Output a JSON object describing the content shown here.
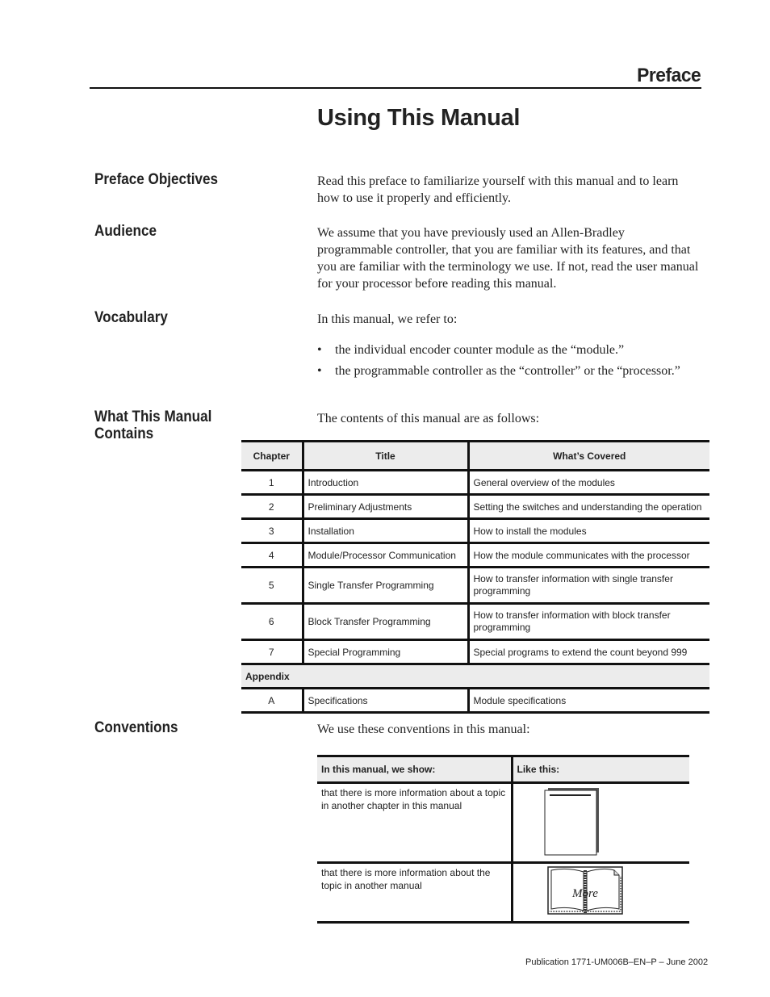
{
  "header": {
    "section_label": "Preface",
    "page_title": "Using This Manual"
  },
  "sections": {
    "objectives": {
      "heading": "Preface Objectives",
      "text": "Read this preface to familiarize yourself with this manual and to learn how to use it properly and efficiently."
    },
    "audience": {
      "heading": "Audience",
      "text": "We assume that you have previously used an Allen-Bradley programmable controller, that you are familiar with its features, and that you are familiar with the terminology we use.  If not, read the user manual for your processor before reading this manual."
    },
    "vocabulary": {
      "heading": "Vocabulary",
      "intro": "In this manual, we refer to:",
      "bullets": [
        "the individual encoder counter module as the “module.”",
        "the programmable controller as the “controller” or the “processor.”"
      ]
    },
    "contents": {
      "heading_line1": "What This Manual",
      "heading_line2": "Contains",
      "intro": "The contents of this manual are as follows:",
      "columns": [
        "Chapter",
        "Title",
        "What’s Covered"
      ],
      "rows": [
        {
          "chapter": "1",
          "title": "Introduction",
          "covered": "General overview of the modules"
        },
        {
          "chapter": "2",
          "title": "Preliminary Adjustments",
          "covered": "Setting the switches and understanding the operation"
        },
        {
          "chapter": "3",
          "title": "Installation",
          "covered": "How to install the modules"
        },
        {
          "chapter": "4",
          "title": "Module/Processor Communication",
          "covered": "How the module communicates with the processor"
        },
        {
          "chapter": "5",
          "title": "Single Transfer Programming",
          "covered": "How to transfer information with single transfer programming"
        },
        {
          "chapter": "6",
          "title": "Block Transfer Programming",
          "covered": "How to transfer information with block transfer programming"
        },
        {
          "chapter": "7",
          "title": "Special Programming",
          "covered": "Special programs to extend the count beyond 999"
        }
      ],
      "appendix_label": "Appendix",
      "appendix_rows": [
        {
          "chapter": "A",
          "title": "Specifications",
          "covered": "Module specifications"
        }
      ]
    },
    "conventions": {
      "heading": "Conventions",
      "intro": "We use these conventions in this manual:",
      "columns": [
        "In this manual, we show:",
        "Like this:"
      ],
      "rows": [
        {
          "text": "that there is more information about a topic in another chapter in this manual",
          "icon": "chapter-page-icon"
        },
        {
          "text": "that there is more information about the topic in another manual",
          "icon": "more-book-icon",
          "icon_label": "More"
        }
      ]
    }
  },
  "footer": {
    "publication": "Publication 1771-UM006B–EN–P – June 2002"
  }
}
